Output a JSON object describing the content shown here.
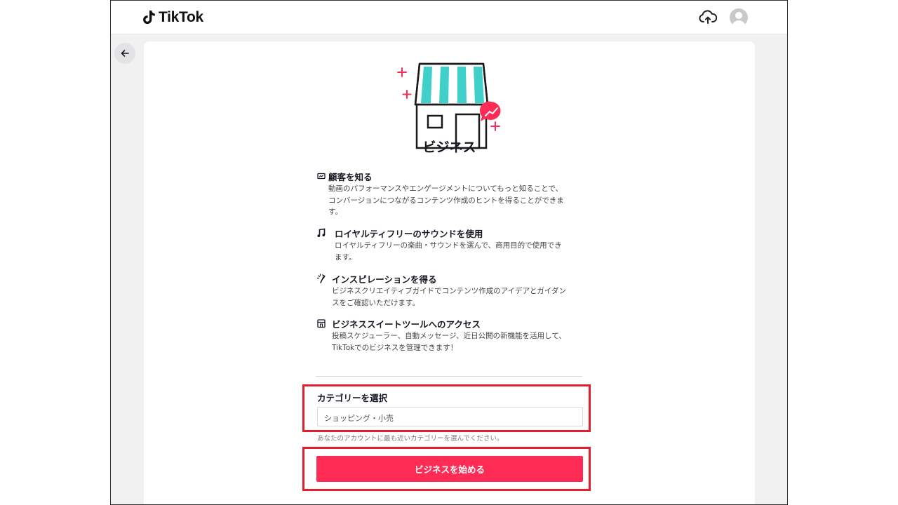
{
  "header": {
    "logo_text": "TikTok",
    "upload_icon": "cloud-upload-icon",
    "avatar": "user-avatar"
  },
  "nav": {
    "back_icon": "arrow-left-icon"
  },
  "main": {
    "title": "ビジネス",
    "features": [
      {
        "icon": "chart-card-icon",
        "title": "顧客を知る",
        "desc_lines": [
          "動画のパフォーマンスやエンゲージメントについてもっと知ることで、",
          "コンバージョンにつながるコンテンツ作成のヒントを得ることができま",
          "す。"
        ]
      },
      {
        "icon": "music-note-icon",
        "title": "ロイヤルティフリーのサウンドを使用",
        "desc_lines": [
          "ロイヤルティフリーの楽曲・サウンドを選んで、商用目的で使用でき",
          "ます。"
        ]
      },
      {
        "icon": "magic-wand-icon",
        "title": "インスピレーションを得る",
        "desc_lines": [
          "ビジネスクリエイティブガイドでコンテンツ作成のアイデアとガイダン",
          "スをご確認いただけます。"
        ]
      },
      {
        "icon": "shop-icon",
        "title": "ビジネススイートツールへのアクセス",
        "desc_lines": [
          "投稿スケジューラー、自動メッセージ、近日公開の新機能を活用して、",
          "TikTokでのビジネスを管理できます！"
        ]
      }
    ],
    "category": {
      "label": "カテゴリーを選択",
      "value": "ショッピング・小売",
      "help": "あなたのアカウントに最も近いカテゴリーを選んでください。"
    },
    "start_button": "ビジネスを始める"
  },
  "colors": {
    "accent": "#fe2c55",
    "highlight": "#e0202e",
    "awning": "#3fd0c9"
  }
}
